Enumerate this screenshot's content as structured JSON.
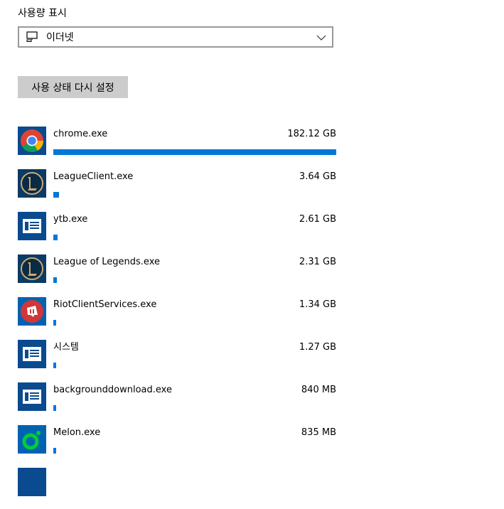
{
  "header": {
    "label": "사용량 표시"
  },
  "dropdown": {
    "selected": "이더넷",
    "icon": "ethernet-icon"
  },
  "reset_button": {
    "label": "사용 상태 다시 설정"
  },
  "colors": {
    "accent": "#0078d7",
    "button_bg": "#cccccc"
  },
  "apps": [
    {
      "name": "chrome.exe",
      "usage": "182.12 GB",
      "usage_fraction": 1.0,
      "icon": "chrome-icon"
    },
    {
      "name": "LeagueClient.exe",
      "usage": "3.64 GB",
      "usage_fraction": 0.02,
      "icon": "league-of-legends-icon"
    },
    {
      "name": "ytb.exe",
      "usage": "2.61 GB",
      "usage_fraction": 0.0143,
      "icon": "default-app-icon"
    },
    {
      "name": "League of Legends.exe",
      "usage": "2.31 GB",
      "usage_fraction": 0.0127,
      "icon": "league-of-legends-icon"
    },
    {
      "name": "RiotClientServices.exe",
      "usage": "1.34 GB",
      "usage_fraction": 0.0074,
      "icon": "riot-client-icon"
    },
    {
      "name": "시스템",
      "usage": "1.27 GB",
      "usage_fraction": 0.007,
      "icon": "default-app-icon"
    },
    {
      "name": "backgrounddownload.exe",
      "usage": "840 MB",
      "usage_fraction": 0.0045,
      "icon": "default-app-icon"
    },
    {
      "name": "Melon.exe",
      "usage": "835 MB",
      "usage_fraction": 0.0045,
      "icon": "melon-icon"
    }
  ]
}
